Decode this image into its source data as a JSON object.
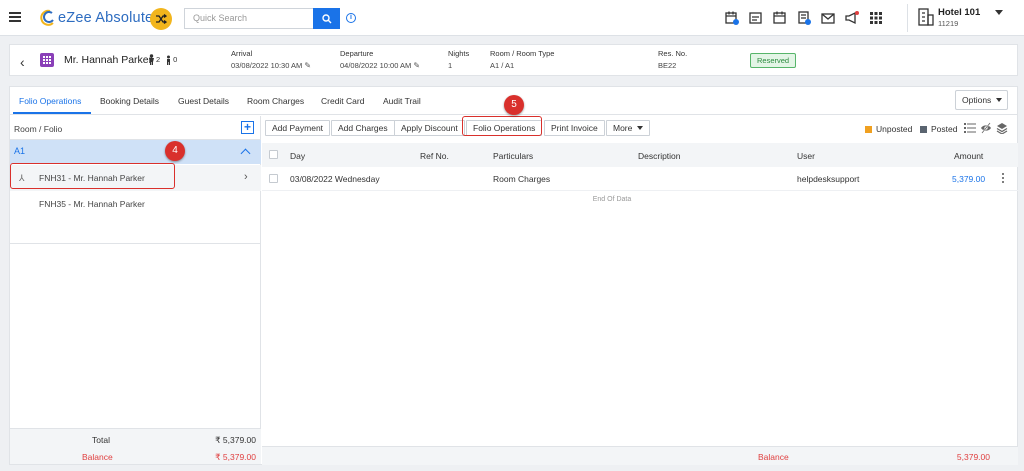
{
  "app": {
    "logo_text": "eZee Absolute",
    "search_placeholder": "Quick Search",
    "hotel_name": "Hotel 101",
    "hotel_id": "11219"
  },
  "guest": {
    "name": "Mr. Hannah Parker",
    "adults": "2",
    "children": "0",
    "arrival_label": "Arrival",
    "arrival_value": "03/08/2022 10:30 AM",
    "departure_label": "Departure",
    "departure_value": "04/08/2022 10:00 AM",
    "nights_label": "Nights",
    "nights_value": "1",
    "room_label": "Room / Room Type",
    "room_value": "A1 / A1",
    "resno_label": "Res. No.",
    "resno_value": "BE22",
    "status": "Reserved"
  },
  "tabs": [
    {
      "label": "Folio Operations"
    },
    {
      "label": "Booking Details"
    },
    {
      "label": "Guest Details"
    },
    {
      "label": "Room Charges"
    },
    {
      "label": "Credit Card"
    },
    {
      "label": "Audit Trail"
    }
  ],
  "options_label": "Options",
  "left_panel": {
    "title": "Room / Folio",
    "group": "A1",
    "folios": [
      {
        "label": "FNH31 - Mr. Hannah Parker"
      },
      {
        "label": "FNH35 - Mr. Hannah Parker"
      }
    ],
    "total_label": "Total",
    "total_value": "₹ 5,379.00",
    "balance_label": "Balance",
    "balance_value": "₹ 5,379.00"
  },
  "toolbar": {
    "add_payment": "Add Payment",
    "add_charges": "Add Charges",
    "apply_discount": "Apply Discount",
    "folio_operations": "Folio Operations",
    "print_invoice": "Print Invoice",
    "more": "More",
    "unposted": "Unposted",
    "posted": "Posted"
  },
  "colors": {
    "accent": "#1a73e8",
    "unposted": "#f0a020",
    "posted": "#5a6470",
    "annotation": "#d9302c"
  },
  "table": {
    "headers": {
      "day": "Day",
      "ref": "Ref No.",
      "particulars": "Particulars",
      "description": "Description",
      "user": "User",
      "amount": "Amount"
    },
    "rows": [
      {
        "day": "03/08/2022 Wednesday",
        "ref": "",
        "particulars": "Room Charges",
        "description": "",
        "user": "helpdesksupport",
        "amount": "5,379.00"
      }
    ],
    "end_text": "End Of Data",
    "balance_label": "Balance",
    "balance_value": "5,379.00"
  },
  "annotations": {
    "step4": "4",
    "step5": "5"
  }
}
